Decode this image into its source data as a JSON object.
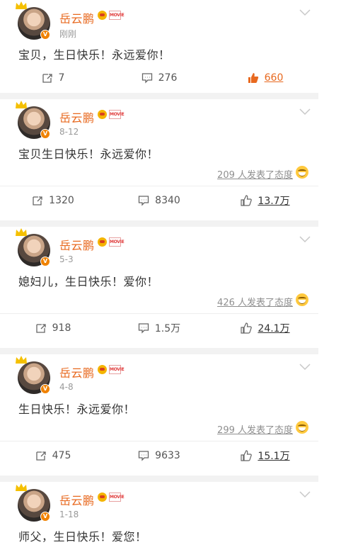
{
  "posts": [
    {
      "user": "岳云鹏",
      "movie_badge": "MOVIE",
      "time": "刚刚",
      "text": "宝贝，生日快乐！永远爱你！",
      "reposts": "7",
      "comments": "276",
      "likes": "660",
      "liked": true,
      "reactions": ""
    },
    {
      "user": "岳云鹏",
      "movie_badge": "MOVIE",
      "time": "8-12",
      "text": "宝贝生日快乐！永远爱你！",
      "reposts": "1320",
      "comments": "8340",
      "likes": "13.7万",
      "liked": false,
      "reactions": "209 人发表了态度"
    },
    {
      "user": "岳云鹏",
      "movie_badge": "MOVIE",
      "time": "5-3",
      "text": "媳妇儿，生日快乐！爱你！",
      "reposts": "918",
      "comments": "1.5万",
      "likes": "24.1万",
      "liked": false,
      "reactions": "426 人发表了态度"
    },
    {
      "user": "岳云鹏",
      "movie_badge": "MOVIE",
      "time": "4-8",
      "text": "生日快乐！永远爱你！",
      "reposts": "475",
      "comments": "9633",
      "likes": "15.1万",
      "liked": false,
      "reactions": "299 人发表了态度"
    },
    {
      "user": "岳云鹏",
      "movie_badge": "MOVIE",
      "time": "1-18",
      "text": "师父，生日快乐！爱您！",
      "reposts": "",
      "comments": "",
      "likes": "",
      "liked": false,
      "reactions": ""
    }
  ],
  "icons": {
    "repost": "repost-icon",
    "comment": "comment-icon",
    "like": "thumbs-up-icon",
    "more": "chevron-down-icon",
    "crown": "crown-icon",
    "verified": "verified-badge-icon"
  },
  "colors": {
    "username": "#e8691f",
    "liked": "#e8691f",
    "text": "#333333",
    "muted": "#999999",
    "separator": "#f2f2f2"
  }
}
